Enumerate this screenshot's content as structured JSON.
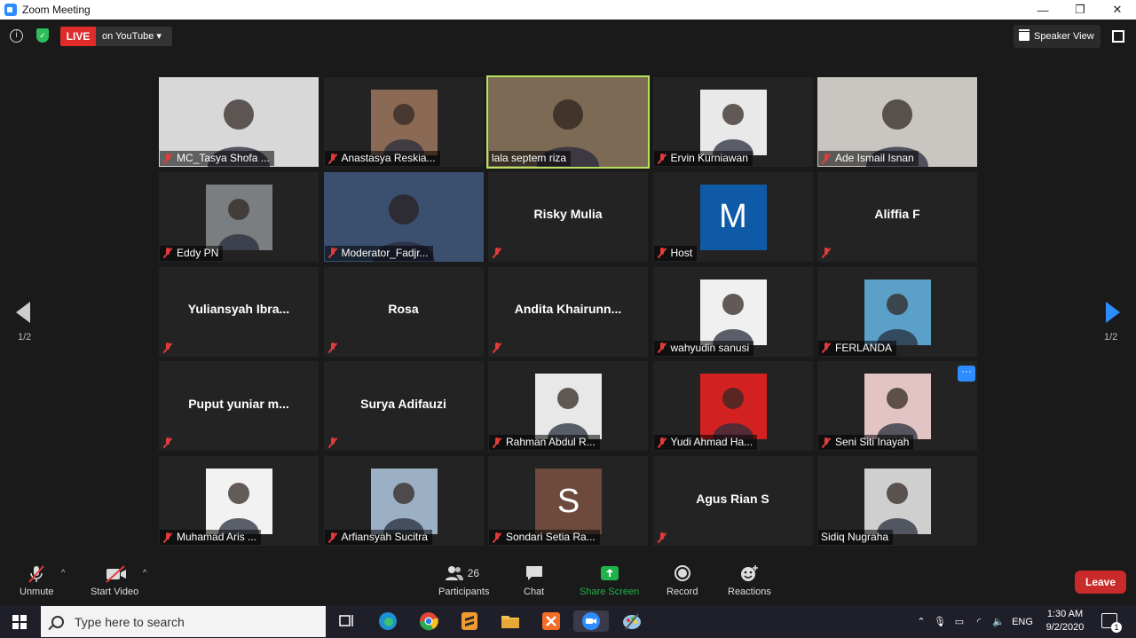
{
  "window": {
    "title": "Zoom Meeting",
    "minimize": "—",
    "maximize": "❐",
    "close": "✕"
  },
  "topbar": {
    "info": "i",
    "live": "LIVE",
    "live_dest": "on YouTube ▾",
    "speaker_view": "Speaker View"
  },
  "tiles": [
    {
      "label": "MC_Tasya Shofa ...",
      "type": "photo",
      "bg": "#d8d8d8"
    },
    {
      "label": "Anastasya Reskia...",
      "type": "avatar",
      "bg": "#8a6a55"
    },
    {
      "label": "lala septem riza",
      "type": "photo",
      "bg": "#7d6a55",
      "active": true
    },
    {
      "label": "Ervin Kurniawan",
      "type": "avatar",
      "bg": "#e9e9e9"
    },
    {
      "label": "Ade Ismail Isnan",
      "type": "photo",
      "bg": "#c9c5c0"
    },
    {
      "label": "Eddy PN",
      "type": "avatar",
      "bg": "#7a7e80"
    },
    {
      "label": "Moderator_Fadjr...",
      "type": "photo",
      "bg": "#3b4f6e"
    },
    {
      "name": "Risky Mulia",
      "type": "name"
    },
    {
      "label": "Host",
      "letter": "M",
      "type": "letter",
      "bg": "#0e5aa7"
    },
    {
      "name": "Aliffia F",
      "type": "name"
    },
    {
      "name": "Yuliansyah  Ibra...",
      "type": "name"
    },
    {
      "name": "Rosa",
      "type": "name"
    },
    {
      "name": "Andita  Khairunn...",
      "type": "name"
    },
    {
      "label": "wahyudin sanusi",
      "type": "avatar",
      "bg": "#f0f0f0"
    },
    {
      "label": "FERLANDA",
      "type": "avatar",
      "bg": "#5aa0c8"
    },
    {
      "name": "Puput  yuniar  m...",
      "type": "name"
    },
    {
      "name": "Surya Adifauzi",
      "type": "name"
    },
    {
      "label": "Rahman Abdul R...",
      "type": "avatar",
      "bg": "#e8e8e8"
    },
    {
      "label": "Yudi Ahmad Ha...",
      "type": "avatar",
      "bg": "#d32020"
    },
    {
      "label": "Seni Siti Inayah",
      "type": "avatar",
      "bg": "#e3c4c4",
      "more": "···"
    },
    {
      "label": "Muhamad Aris ...",
      "type": "avatar",
      "bg": "#f2f2f2"
    },
    {
      "label": "Arfiansyah Sucitra",
      "type": "avatar",
      "bg": "#9bb0c4"
    },
    {
      "label": "Sondari Setia Ra...",
      "letter": "S",
      "type": "letter",
      "bg": "#6e4a3c"
    },
    {
      "name": "Agus Rian S",
      "type": "name"
    },
    {
      "label": "Sidiq Nugraha",
      "type": "avatar",
      "bg": "#cfcfcf",
      "unmuted": true
    }
  ],
  "pager": {
    "left": "1/2",
    "right": "1/2"
  },
  "toolbar": {
    "unmute": "Unmute",
    "start_video": "Start Video",
    "participants": "Participants",
    "participant_count": "26",
    "chat": "Chat",
    "share_screen": "Share Screen",
    "record": "Record",
    "reactions": "Reactions",
    "leave": "Leave"
  },
  "taskbar": {
    "search_placeholder": "Type here to search",
    "language": "ENG",
    "time": "1:30 AM",
    "date": "9/2/2020",
    "notification_count": "1"
  },
  "colors": {
    "accent": "#2d8cff",
    "live": "#e02b2b",
    "leave": "#c92a2a",
    "active_speaker": "#b5e35c",
    "muted": "#e23b3b",
    "share": "#1fb24a"
  }
}
